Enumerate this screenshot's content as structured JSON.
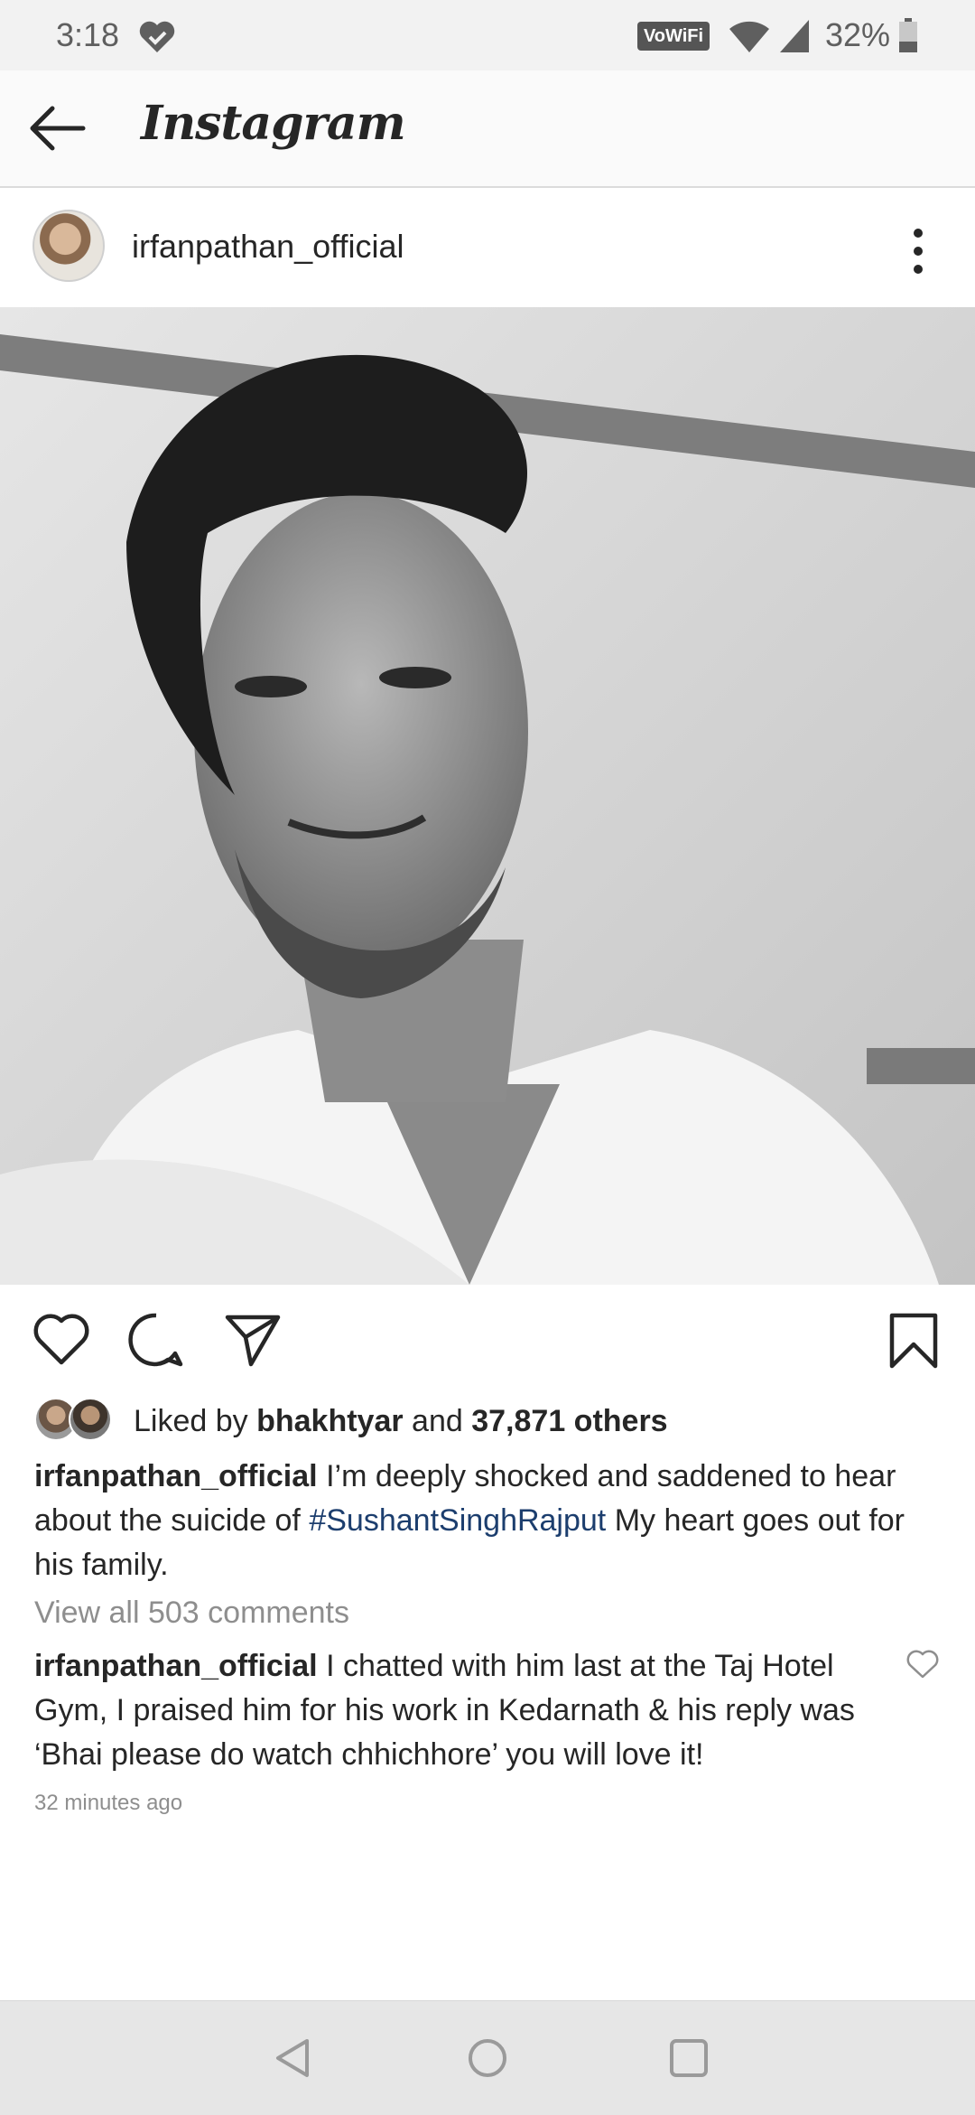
{
  "status_bar": {
    "time": "3:18",
    "vowifi": "VoWiFi",
    "battery": "32%"
  },
  "header": {
    "title": "Instagram"
  },
  "post": {
    "username": "irfanpathan_official",
    "image_description_icon": "portrait-photo",
    "likes": {
      "prefix": "Liked by",
      "liker": "bhakhtyar",
      "connector": "and",
      "others": "37,871 others"
    },
    "caption": {
      "username": "irfanpathan_official",
      "text_before": "I’m deeply shocked and saddened to hear about the suicide of",
      "hashtag": "#SushantSinghRajput",
      "text_after": "My heart goes out for his family."
    },
    "view_comments": "View all 503 comments",
    "comment": {
      "username": "irfanpathan_official",
      "text": "I chatted with him last at the Taj Hotel Gym, I praised him for his work in Kedarnath & his reply was ‘Bhai please do watch chhichhore’ you will love it!"
    },
    "timestamp": "32 minutes ago"
  },
  "colors": {
    "hashtag": "#1c3e6e",
    "muted": "#8e8e8e",
    "text": "#262626"
  }
}
